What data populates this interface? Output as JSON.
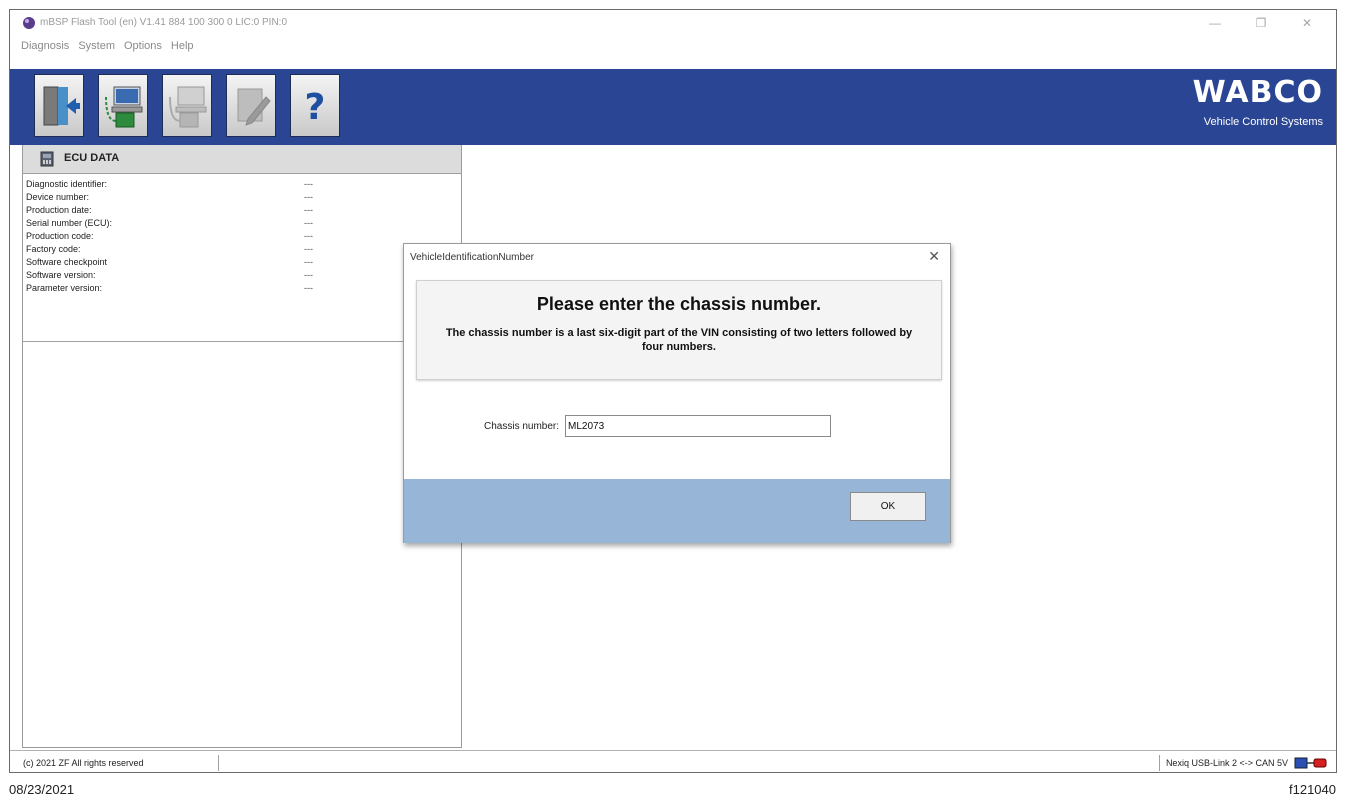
{
  "window": {
    "title": "mBSP Flash Tool (en) V1.41  884 100 300 0  LIC:0 PIN:0",
    "controls": [
      "minimize-icon",
      "restore-icon",
      "close-icon"
    ]
  },
  "menu": [
    "Diagnosis",
    "System",
    "Options",
    "Help"
  ],
  "toolbar": {
    "buttons": [
      "exit-icon",
      "ecu-connect-icon",
      "ecu-disconnect-icon",
      "edit-icon",
      "help-icon"
    ]
  },
  "brand": {
    "name": "WABCO",
    "subtitle": "Vehicle Control Systems"
  },
  "panel": {
    "title": "ECU DATA",
    "rows": [
      {
        "label": "Diagnostic identifier:",
        "value": "---"
      },
      {
        "label": "Device number:",
        "value": "---"
      },
      {
        "label": "Production date:",
        "value": "---"
      },
      {
        "label": "Serial number (ECU):",
        "value": "---"
      },
      {
        "label": "Production code:",
        "value": "---"
      },
      {
        "label": "Factory code:",
        "value": "---"
      },
      {
        "label": "Software checkpoint",
        "value": "---"
      },
      {
        "label": "Software version:",
        "value": "---"
      },
      {
        "label": "Parameter version:",
        "value": "---"
      }
    ]
  },
  "dialog": {
    "title": "VehicleIdentificationNumber",
    "heading": "Please enter the chassis number.",
    "description": "The chassis number is a last six-digit part of the VIN consisting of two letters followed by four numbers.",
    "field_label": "Chassis number:",
    "field_value": "ML2073",
    "ok_label": "OK"
  },
  "status": {
    "copyright": "(c) 2021 ZF All rights reserved",
    "connection": "Nexiq USB-Link 2 <-> CAN 5V"
  },
  "caption": {
    "date": "08/23/2021",
    "figure_id": "f121040"
  },
  "colors": {
    "toolbar_bg": "#2a4593",
    "dialog_footer": "#97b5d6"
  }
}
